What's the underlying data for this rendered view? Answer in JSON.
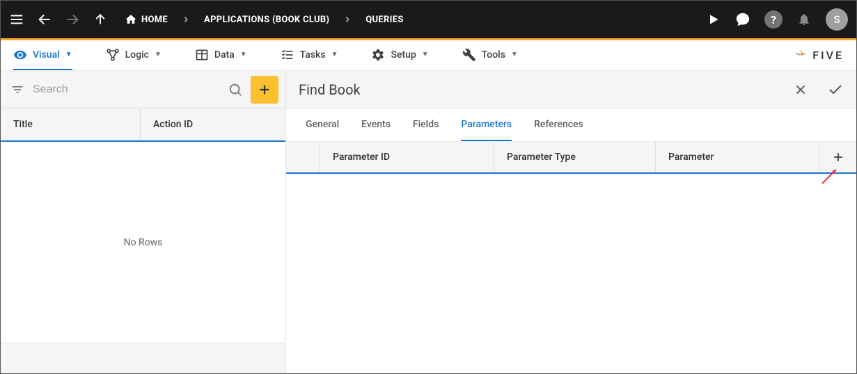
{
  "topbar": {
    "breadcrumbs": [
      "HOME",
      "APPLICATIONS (BOOK CLUB)",
      "QUERIES"
    ],
    "avatar_initial": "S"
  },
  "nav": {
    "items": [
      {
        "label": "Visual"
      },
      {
        "label": "Logic"
      },
      {
        "label": "Data"
      },
      {
        "label": "Tasks"
      },
      {
        "label": "Setup"
      },
      {
        "label": "Tools"
      }
    ],
    "logo_text": "FIVE"
  },
  "left": {
    "search_placeholder": "Search",
    "columns": {
      "title": "Title",
      "action_id": "Action ID"
    },
    "empty_text": "No Rows"
  },
  "detail": {
    "title": "Find Book",
    "tabs": [
      "General",
      "Events",
      "Fields",
      "Parameters",
      "References"
    ],
    "active_tab": "Parameters",
    "param_columns": {
      "id": "Parameter ID",
      "type": "Parameter Type",
      "param": "Parameter"
    }
  }
}
